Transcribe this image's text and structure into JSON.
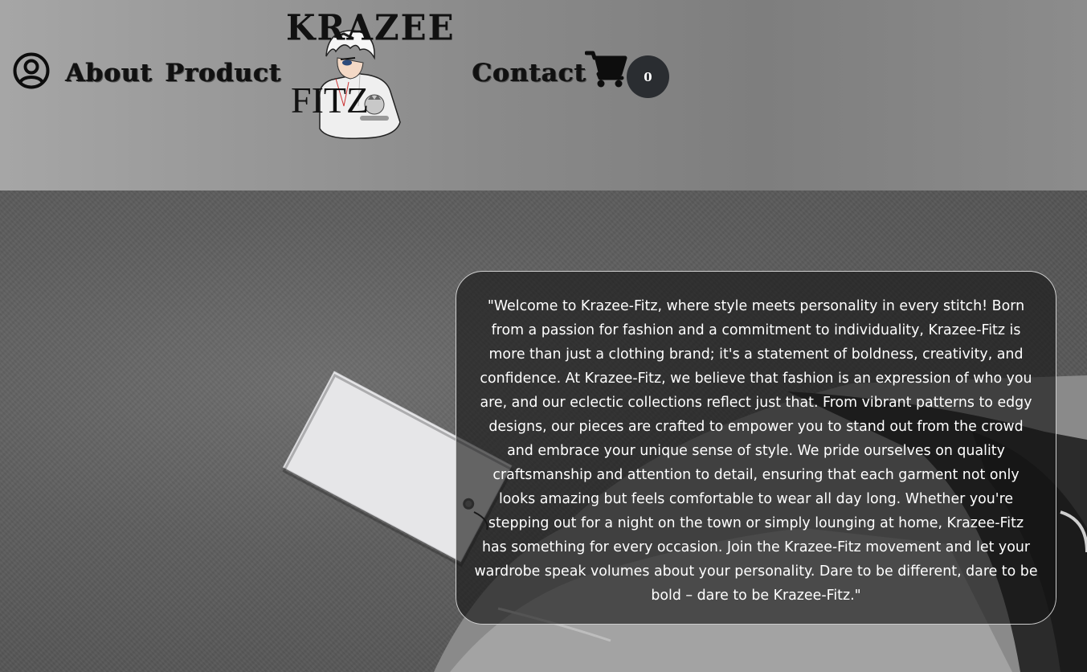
{
  "header": {
    "nav": {
      "about_label": "About",
      "product_label": "Product",
      "contact_label": "Contact"
    },
    "logo": {
      "top_text": "KRAZEE",
      "bottom_text": "FITZ"
    },
    "cart": {
      "count": "0"
    },
    "icons": {
      "profile": "user-circle-icon",
      "cart": "shopping-cart-icon"
    },
    "colors": {
      "nav_text": "#111111",
      "badge_bg": "#2a2d31"
    }
  },
  "hero": {
    "about_text": "\"Welcome to Krazee-Fitz, where style meets personality in every stitch! Born from a passion for fashion and a commitment to individuality, Krazee-Fitz is more than just a clothing brand; it's a statement of boldness, creativity, and confidence. At Krazee-Fitz, we believe that fashion is an expression of who you are, and our eclectic collections reflect just that. From vibrant patterns to edgy designs, our pieces are crafted to empower you to stand out from the crowd and embrace your unique sense of style. We pride ourselves on quality craftsmanship and attention to detail, ensuring that each garment not only looks amazing but feels comfortable to wear all day long. Whether you're stepping out for a night on the town or simply lounging at home, Krazee-Fitz has something for every occasion. Join the Krazee-Fitz movement and let your wardrobe speak volumes about your personality. Dare to be different, dare to be bold – dare to be Krazee-Fitz.\""
  }
}
